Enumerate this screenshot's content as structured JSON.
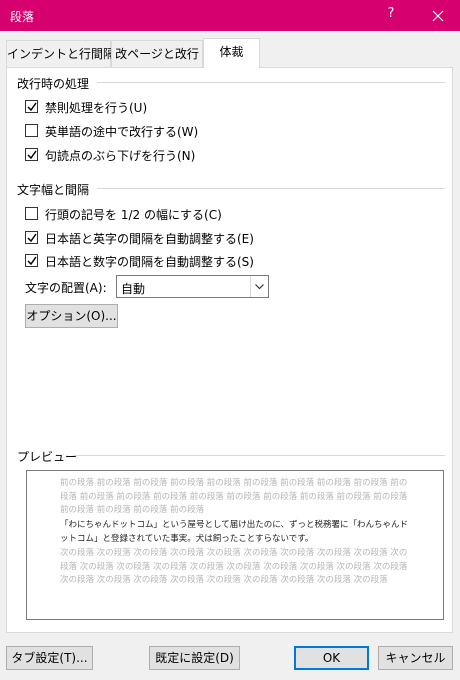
{
  "window": {
    "title": "段落",
    "help": "?",
    "close_icon": "close-icon"
  },
  "tabs": [
    {
      "label": "インデントと行間隔",
      "active": false
    },
    {
      "label": "改ページと改行",
      "active": false
    },
    {
      "label": "体裁",
      "active": true
    }
  ],
  "line_break": {
    "title": "改行時の処理",
    "options": [
      {
        "label": "禁則処理を行う(U)",
        "checked": true
      },
      {
        "label": "英単語の途中で改行する(W)",
        "checked": false
      },
      {
        "label": "句読点のぶら下げを行う(N)",
        "checked": true
      }
    ]
  },
  "char_spacing": {
    "title": "文字幅と間隔",
    "options": [
      {
        "label": "行頭の記号を 1/2 の幅にする(C)",
        "checked": false
      },
      {
        "label": "日本語と英字の間隔を自動調整する(E)",
        "checked": true
      },
      {
        "label": "日本語と数字の間隔を自動調整する(S)",
        "checked": true
      }
    ],
    "alignment_label": "文字の配置(A):",
    "alignment_value": "自動",
    "options_button": "オプション(O)..."
  },
  "preview": {
    "title": "プレビュー",
    "before_text": "前の段落 前の段落 前の段落 前の段落 前の段落 前の段落 前の段落 前の段落 前の段落 前の段落 前の段落 前の段落 前の段落 前の段落 前の段落 前の段落 前の段落 前の段落 前の段落 前の段落 前の段落 前の段落 前の段落",
    "current_text": "「わにちゃんドットコム」という屋号として届け出たのに、ずっと税務署に「わんちゃんドットコム」と登録されていた事実。犬は飼ったことすらないです。",
    "after_text": "次の段落 次の段落 次の段落 次の段落 次の段落 次の段落 次の段落 次の段落 次の段落 次の段落 次の段落 次の段落 次の段落 次の段落 次の段落 次の段落 次の段落 次の段落 次の段落 次の段落 次の段落 次の段落 次の段落 次の段落 次の段落 次の段落 次の段落 次の段落"
  },
  "footer": {
    "tabs_button": "タブ設定(T)...",
    "default_button": "既定に設定(D)",
    "ok_button": "OK",
    "cancel_button": "キャンセル"
  }
}
